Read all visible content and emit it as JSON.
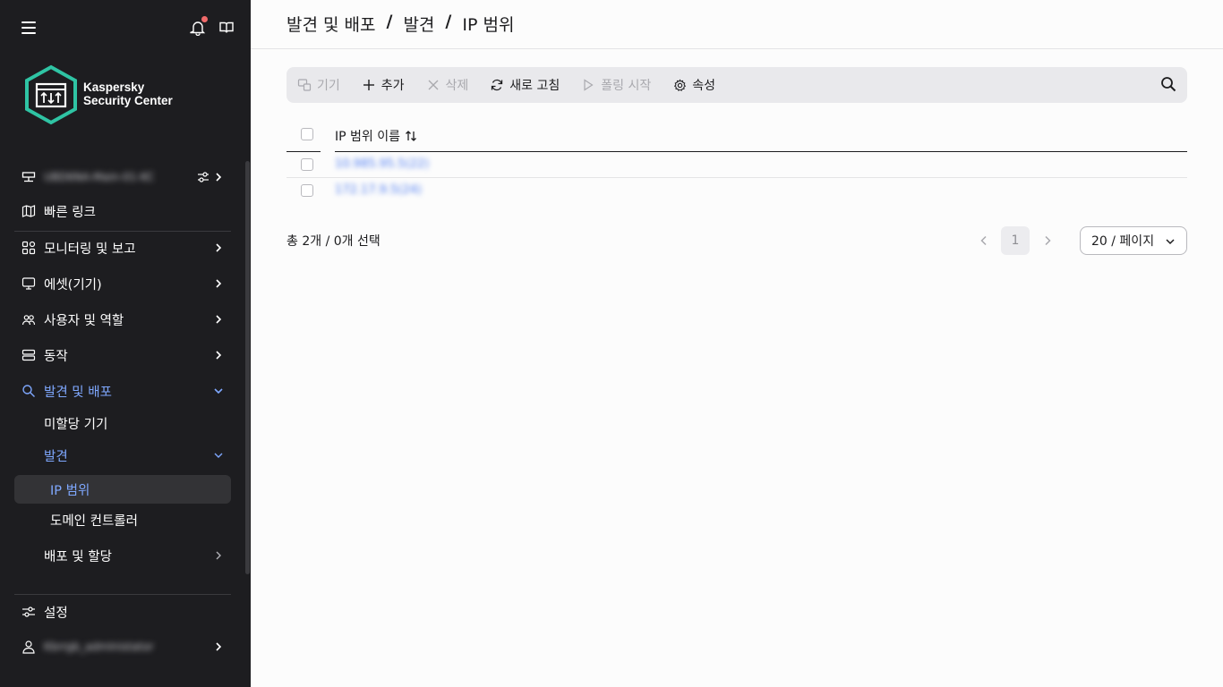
{
  "sidebar": {
    "server_name": "UBD6NA-Main-01-KC",
    "quick_links": "빠른 링크",
    "items": [
      {
        "label": "모니터링 및 보고"
      },
      {
        "label": "에셋(기기)"
      },
      {
        "label": "사용자 및 역할"
      },
      {
        "label": "동작"
      },
      {
        "label": "발견 및 배포"
      }
    ],
    "sub_items": {
      "unassigned": "미할당 기기",
      "discovery": "발견",
      "ip_ranges": "IP 범위",
      "domain_controllers": "도메인 컨트롤러",
      "deploy": "배포 및 할당"
    },
    "settings": "설정",
    "user": "Kbrrgb_admInistator",
    "logo_line1": "Kaspersky",
    "logo_line2": "Security Center"
  },
  "header": {
    "crumb1": "발견 및 배포",
    "crumb2": "발견",
    "crumb3": "IP 범위",
    "separator": "/"
  },
  "toolbar": {
    "devices": "기기",
    "add": "추가",
    "delete": "삭제",
    "refresh": "새로 고침",
    "start_polling": "폴링 시작",
    "properties": "속성"
  },
  "table": {
    "column": "IP 범위 이름",
    "rows": [
      "10.985.95.5(22)",
      "172.17.9.5(24)"
    ]
  },
  "footer": {
    "total": "총 2개 / 0개 선택",
    "page": "1",
    "page_size": "20 / 페이지"
  },
  "colors": {
    "sidebar_bg": "#1d1d20",
    "accent": "#7fa8ff",
    "link": "#4d7cf2",
    "notification": "#f06a6a"
  }
}
